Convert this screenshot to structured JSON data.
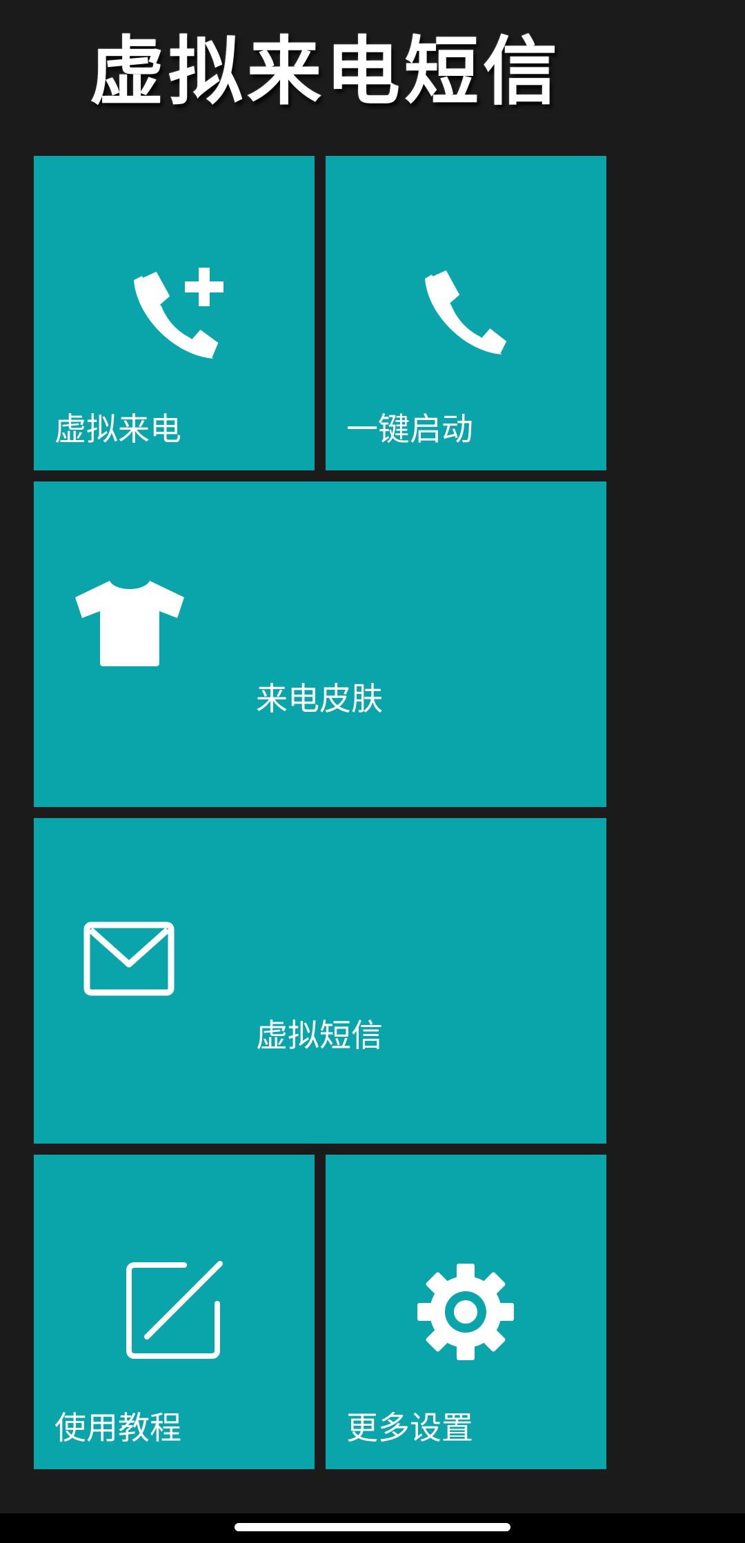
{
  "app": {
    "title": "虚拟来电短信"
  },
  "tiles": {
    "fake_call": {
      "label": "虚拟来电",
      "icon": "phone-add-icon"
    },
    "one_key_start": {
      "label": "一键启动",
      "icon": "phone-icon"
    },
    "call_skin": {
      "label": "来电皮肤",
      "icon": "tshirt-icon"
    },
    "fake_sms": {
      "label": "虚拟短信",
      "icon": "envelope-icon"
    },
    "tutorial": {
      "label": "使用教程",
      "icon": "edit-icon"
    },
    "more_settings": {
      "label": "更多设置",
      "icon": "gear-icon"
    }
  },
  "colors": {
    "background": "#1b1b1b",
    "tile": "#0aa5ab",
    "text": "#ffffff"
  }
}
